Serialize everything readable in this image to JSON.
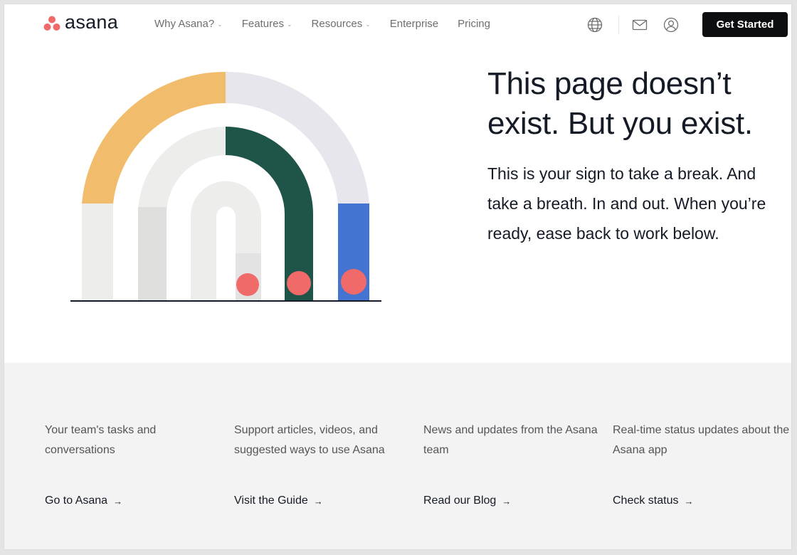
{
  "brand": {
    "name": "asana",
    "logo_icon": "asana-three-dots-logo",
    "logo_color": "#f06a6a"
  },
  "nav": {
    "links": [
      {
        "label": "Why Asana?",
        "has_dropdown": true
      },
      {
        "label": "Features",
        "has_dropdown": true
      },
      {
        "label": "Resources",
        "has_dropdown": true
      },
      {
        "label": "Enterprise",
        "has_dropdown": false
      },
      {
        "label": "Pricing",
        "has_dropdown": false
      }
    ],
    "dropdown_icon": "chevron-down-icon",
    "icons": [
      "globe-icon",
      "mail-icon",
      "user-icon"
    ],
    "cta_label": "Get Started"
  },
  "hero": {
    "headline": "This page doesn’t exist. But you exist.",
    "body": "This is your sign to take a break. And take a breath. In and out. When you’re ready, ease back to work below."
  },
  "illustration": {
    "description": "rainbow-arch",
    "colors": {
      "yellow": "#f1bd6c",
      "lavender": "#e6e6ec",
      "dark_green": "#1f5449",
      "blue": "#4573d2",
      "light_gray": "#ededec",
      "mid_gray": "#dfdfde",
      "coral": "#f06a6a",
      "baseline": "#151b26"
    }
  },
  "footer": {
    "columns": [
      {
        "description": "Your team's tasks and conversations",
        "link": "Go to Asana"
      },
      {
        "description": "Support articles, videos, and suggested ways to use Asana",
        "link": "Visit the Guide"
      },
      {
        "description": "News and updates from the Asana team",
        "link": "Read our Blog"
      },
      {
        "description": "Real-time status updates about the Asana app",
        "link": "Check status"
      }
    ],
    "arrow_glyph": "→"
  }
}
